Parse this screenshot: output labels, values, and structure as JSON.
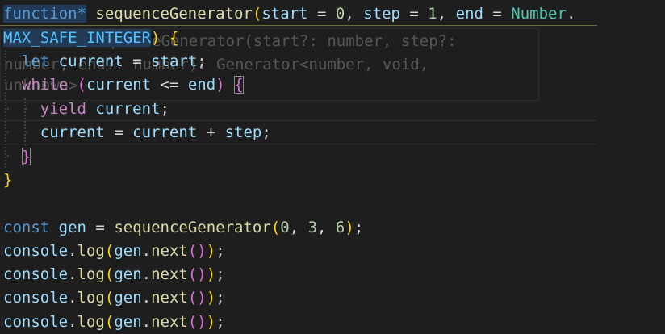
{
  "editor": {
    "language": "javascript",
    "parameter_hint": {
      "line1": "function sequenceGenerator(start?: number, step?:",
      "line2": "number, end?: number): Generator<number, void,",
      "line3": "unknown>"
    },
    "code": {
      "l1_keyword": "function*",
      "l1_fn": "sequenceGenerator",
      "l1_paren": "(",
      "l1_p1": "start",
      "l1_eq1": " = ",
      "l1_v1": "0",
      "l1_comma1": ", ",
      "l1_p2": "step",
      "l1_eq2": " = ",
      "l1_v2": "1",
      "l1_comma2": ", ",
      "l1_p3": "end",
      "l1_eq3": " = ",
      "l1_obj": "Number",
      "l1_dot": ".",
      "l2_const": "MAX_SAFE_INTEGER",
      "l2_paren": ")",
      "l2_brace": " {",
      "l3_let": "let",
      "l3_var": "current",
      "l3_eq": " = ",
      "l3_start": "start",
      "l3_semi": ";",
      "l4_while": "while",
      "l4_open": "(",
      "l4_var": "current",
      "l4_op": " <= ",
      "l4_end": "end",
      "l4_close": ")",
      "l4_brace": "{",
      "l5_yield": "yield",
      "l5_var": "current",
      "l5_semi": ";",
      "l6_var1": "current",
      "l6_eq": " = ",
      "l6_var2": "current",
      "l6_plus": " + ",
      "l6_step": "step",
      "l6_semi": ";",
      "l7_brace": "}",
      "l8_brace": "}",
      "l10_const": "const",
      "l10_var": "gen",
      "l10_eq": " = ",
      "l10_fn": "sequenceGenerator",
      "l10_open": "(",
      "l10_a1": "0",
      "l10_c1": ", ",
      "l10_a2": "3",
      "l10_c2": ", ",
      "l10_a3": "6",
      "l10_close": ")",
      "l10_semi": ";",
      "log_obj": "console",
      "log_dot1": ".",
      "log_fn": "log",
      "log_open": "(",
      "log_var": "gen",
      "log_dot2": ".",
      "log_next": "next",
      "log_inner": "()",
      "log_close": ")",
      "log_semi": ";"
    }
  }
}
